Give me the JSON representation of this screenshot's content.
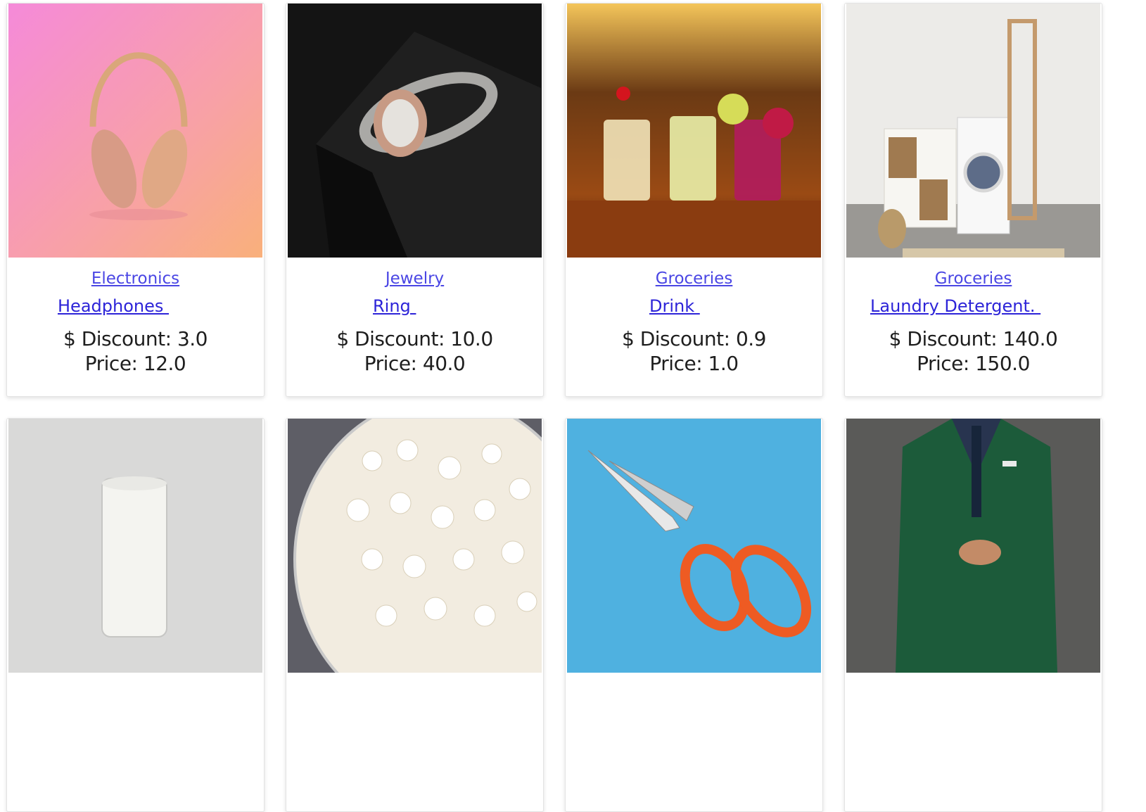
{
  "products": [
    {
      "category": "Electronics",
      "name": "Headphones ",
      "discount_text": "$ Discount: 3.0",
      "price_text": "Price: 12.0",
      "image": "headphones-photo"
    },
    {
      "category": "Jewelry",
      "name": "Ring ",
      "discount_text": "$ Discount: 10.0",
      "price_text": "Price: 40.0",
      "image": "ring-photo"
    },
    {
      "category": "Groceries",
      "name": "Drink ",
      "discount_text": "$ Discount: 0.9",
      "price_text": "Price: 1.0",
      "image": "drinks-photo"
    },
    {
      "category": "Groceries",
      "name": "Laundry Detergent. ",
      "discount_text": "$ Discount: 140.0",
      "price_text": "Price: 150.0",
      "image": "laundry-photo"
    },
    {
      "image": "milk-photo"
    },
    {
      "image": "popcorn-photo"
    },
    {
      "image": "scissors-photo"
    },
    {
      "image": "suit-photo"
    }
  ]
}
